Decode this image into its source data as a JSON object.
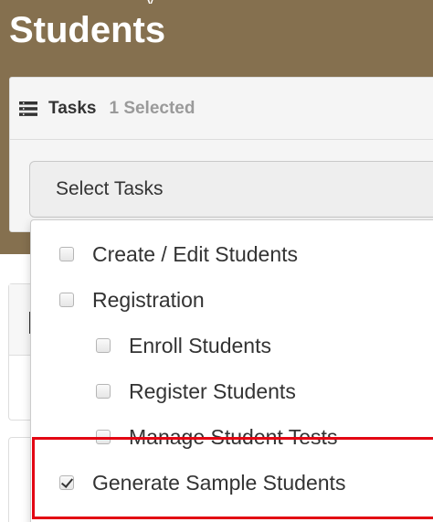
{
  "header": {
    "title": "Students",
    "cropped_fragment": "y"
  },
  "tasks": {
    "icon": "list-icon",
    "label": "Tasks",
    "selected_count": "1 Selected",
    "dropdown_placeholder": "Select Tasks"
  },
  "menu": {
    "items": [
      {
        "label": "Create / Edit Students",
        "checked": false
      },
      {
        "label": "Registration",
        "checked": false
      },
      {
        "label": "Enroll Students",
        "checked": false
      },
      {
        "label": "Register Students",
        "checked": false
      },
      {
        "label": "Manage Student Tests",
        "checked": false
      },
      {
        "label": "Generate Sample Students",
        "checked": true
      }
    ]
  },
  "colors": {
    "header_brown": "#85704f",
    "highlight_red": "#e30613",
    "muted_gray": "#9a9a9a"
  }
}
